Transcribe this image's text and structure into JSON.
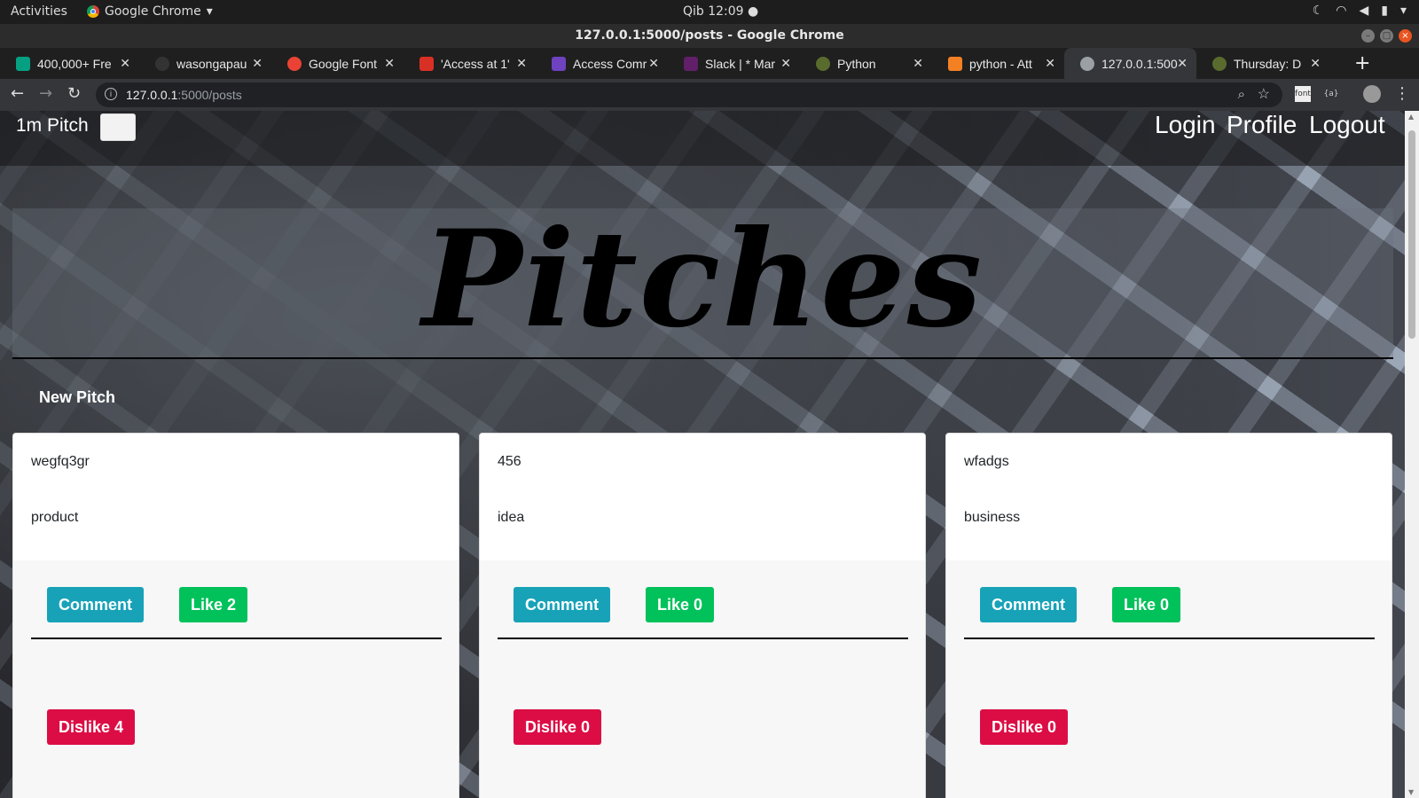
{
  "system_bar": {
    "activities": "Activities",
    "app_name": "Google Chrome",
    "clock": "Qib 12:09 ●"
  },
  "window": {
    "title": "127.0.0.1:5000/posts - Google Chrome"
  },
  "tabs": [
    {
      "title": "400,000+ Fre",
      "favicon_color": "#05a081",
      "favicon_text": "px"
    },
    {
      "title": "wasongapau",
      "favicon_color": "#333333",
      "favicon_text": ""
    },
    {
      "title": "Google Font",
      "favicon_color": "#ea4335",
      "favicon_text": "F"
    },
    {
      "title": "'Access at 1'",
      "favicon_color": "#d93025",
      "favicon_text": "M"
    },
    {
      "title": "Access Comr",
      "favicon_color": "#6f42c1",
      "favicon_text": "☰"
    },
    {
      "title": "Slack | * Mar",
      "favicon_color": "#611f69",
      "favicon_text": "#"
    },
    {
      "title": "Python",
      "favicon_color": "#5a6b2e",
      "favicon_text": ""
    },
    {
      "title": "python - Att",
      "favicon_color": "#f48024",
      "favicon_text": ""
    },
    {
      "title": "127.0.0.1:500",
      "favicon_color": "#9aa0a6",
      "favicon_text": ""
    },
    {
      "title": "Thursday: D",
      "favicon_color": "#5a6b2e",
      "favicon_text": ""
    }
  ],
  "toolbar": {
    "url_host": "127.0.0.1",
    "url_path": ":5000/posts"
  },
  "app": {
    "brand": "1m Pitch",
    "nav": [
      "Login",
      "Profile",
      "Logout"
    ],
    "heading": "Pitches",
    "new_pitch": "New Pitch"
  },
  "cards": [
    {
      "title": "wegfq3gr",
      "category": "product",
      "comment": "Comment",
      "like": "Like 2",
      "dislike": "Dislike 4"
    },
    {
      "title": "456",
      "category": "idea",
      "comment": "Comment",
      "like": "Like 0",
      "dislike": "Dislike 0"
    },
    {
      "title": "wfadgs",
      "category": "business",
      "comment": "Comment",
      "like": "Like 0",
      "dislike": "Dislike 0"
    }
  ]
}
